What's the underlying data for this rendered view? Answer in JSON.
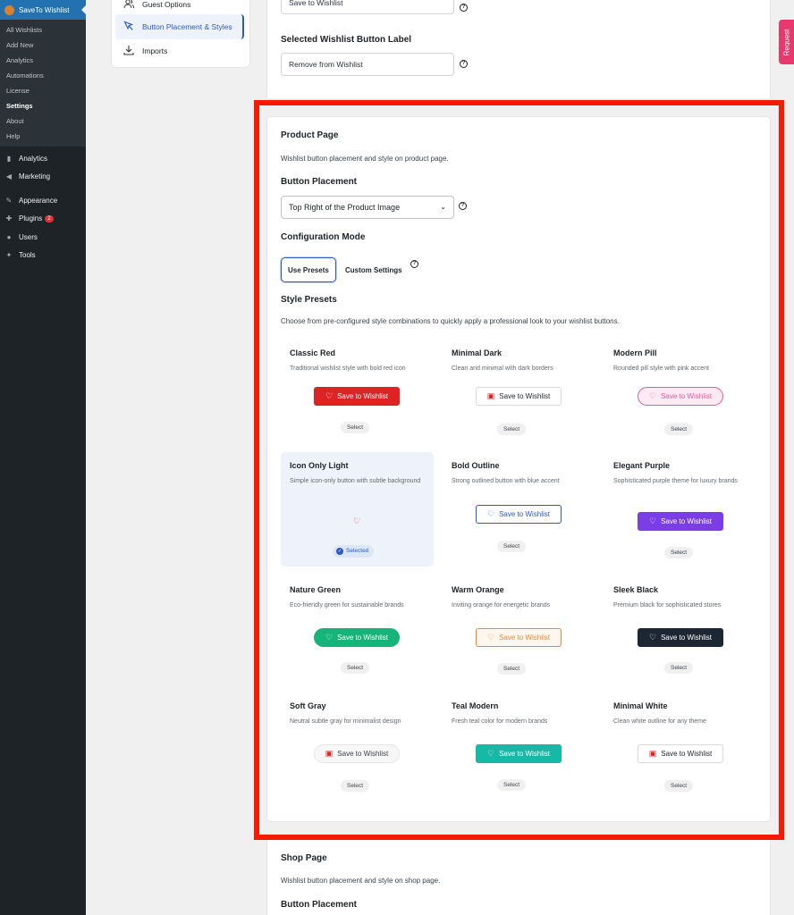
{
  "wp_sidebar": {
    "plugin_title": "SaveTo Wishlist",
    "submenu": [
      "All Wishlists",
      "Add New",
      "Analytics",
      "Automations",
      "License",
      "Settings",
      "About",
      "Help"
    ],
    "menu": [
      {
        "label": "Analytics",
        "icon": "bar-chart-icon"
      },
      {
        "label": "Marketing",
        "icon": "megaphone-icon"
      },
      {
        "label": "Appearance",
        "icon": "paintbrush-icon"
      },
      {
        "label": "Plugins",
        "icon": "plugin-icon",
        "badge": "2"
      },
      {
        "label": "Users",
        "icon": "user-icon"
      },
      {
        "label": "Tools",
        "icon": "wrench-icon"
      }
    ]
  },
  "settings_nav": [
    {
      "label": "Guest Options",
      "icon": "users-icon"
    },
    {
      "label": "Button Placement & Styles",
      "icon": "cursor-icon",
      "active": true
    },
    {
      "label": "Imports",
      "icon": "download-icon"
    }
  ],
  "top_section": {
    "wishlist_label_value": "Save to Wishlist",
    "selected_label_title": "Selected Wishlist Button Label",
    "selected_label_value": "Remove from Wishlist"
  },
  "product_page": {
    "title": "Product Page",
    "description": "Wishlist button placement and style on product page.",
    "placement_label": "Button Placement",
    "placement_value": "Top Right of the Product Image",
    "config_mode_label": "Configuration Mode",
    "mode_use_presets": "Use Presets",
    "mode_custom": "Custom Settings",
    "style_presets_label": "Style Presets",
    "style_presets_desc": "Choose from pre-configured style combinations to quickly apply a professional look to your wishlist buttons.",
    "presets": [
      {
        "name": "Classic Red",
        "desc": "Traditional wishlist style with bold red icon",
        "button": "Save to Wishlist",
        "status": "Select"
      },
      {
        "name": "Minimal Dark",
        "desc": "Clean and minimal with dark borders",
        "button": "Save to Wishlist",
        "status": "Select"
      },
      {
        "name": "Modern Pill",
        "desc": "Rounded pill style with pink accent",
        "button": "Save to Wishlist",
        "status": "Select"
      },
      {
        "name": "Icon Only Light",
        "desc": "Simple icon-only button with subtle background",
        "button": "",
        "status": "Selected"
      },
      {
        "name": "Bold Outline",
        "desc": "Strong outlined button with blue accent",
        "button": "Save to Wishlist",
        "status": "Select"
      },
      {
        "name": "Elegant Purple",
        "desc": "Sophisticated purple theme for luxury brands",
        "button": "Save to Wishlist",
        "status": "Select"
      },
      {
        "name": "Nature Green",
        "desc": "Eco-friendly green for sustainable brands",
        "button": "Save to Wishlist",
        "status": "Select"
      },
      {
        "name": "Warm Orange",
        "desc": "Inviting orange for energetic brands",
        "button": "Save to Wishlist",
        "status": "Select"
      },
      {
        "name": "Sleek Black",
        "desc": "Premium black for sophisticated stores",
        "button": "Save to Wishlist",
        "status": "Select"
      },
      {
        "name": "Soft Gray",
        "desc": "Neutral subtle gray for minimalist design",
        "button": "Save to Wishlist",
        "status": "Select"
      },
      {
        "name": "Teal Modern",
        "desc": "Fresh teal color for modern brands",
        "button": "Save to Wishlist",
        "status": "Select"
      },
      {
        "name": "Minimal White",
        "desc": "Clean white outline for any theme",
        "button": "Save to Wishlist",
        "status": "Select"
      }
    ]
  },
  "shop_page": {
    "title": "Shop Page",
    "description": "Wishlist button placement and style on shop page.",
    "placement_label": "Button Placement"
  },
  "request_tab": "Request",
  "colors": {
    "accent": "#2c59c7",
    "highlight_frame": "#f51b00",
    "wp_sidebar": "#1d2327"
  }
}
